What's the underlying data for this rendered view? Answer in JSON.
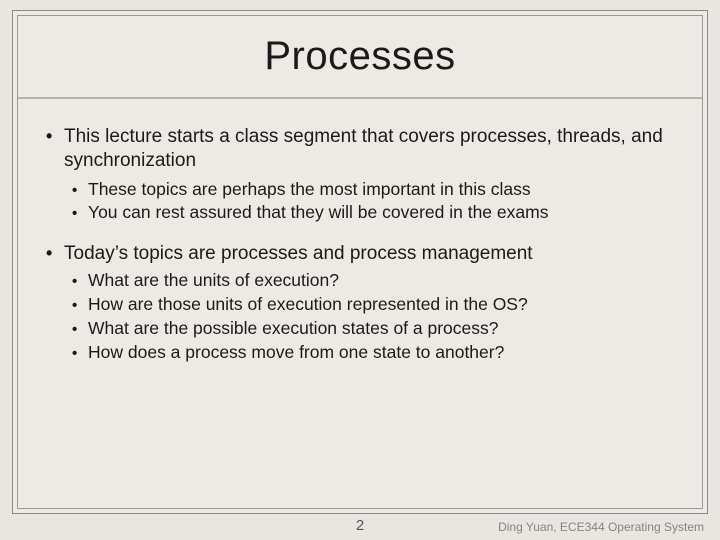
{
  "slide": {
    "title": "Processes",
    "bullets": [
      {
        "text": "This lecture starts a class segment that covers processes, threads, and synchronization",
        "sub": [
          "These topics are perhaps the most important in this class",
          "You can rest assured that they will be covered in the exams"
        ]
      },
      {
        "text": "Today’s topics are processes and process management",
        "sub": [
          "What are the units of execution?",
          "How are those units of execution represented in the OS?",
          "What are the possible execution states of a process?",
          "How does a process move from one state to another?"
        ]
      }
    ]
  },
  "footer": {
    "page": "2",
    "attrib": "Ding Yuan, ECE344 Operating System"
  }
}
